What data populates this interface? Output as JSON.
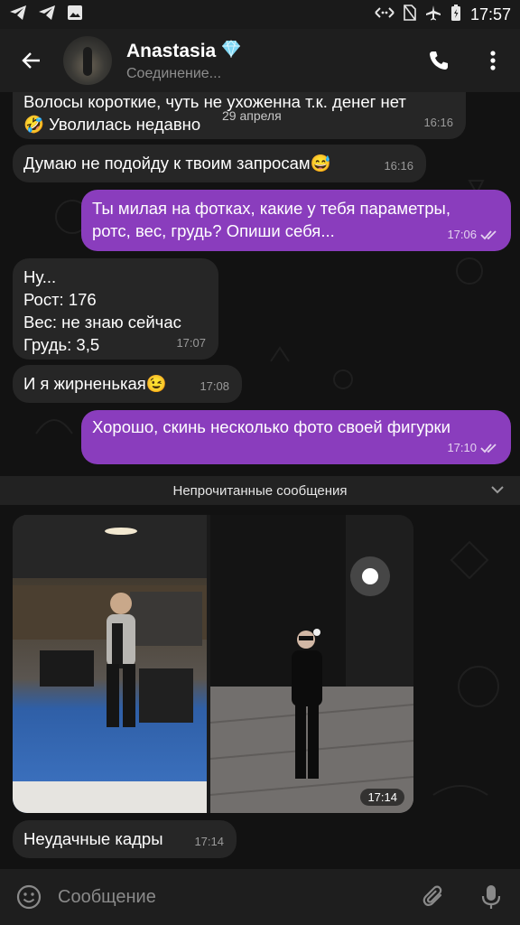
{
  "status_bar": {
    "time": "17:57"
  },
  "header": {
    "name": "Anastasia",
    "status": "Соединение...",
    "verified_icon": "diamond-icon"
  },
  "date_float": "29 апреля",
  "messages": [
    {
      "dir": "in",
      "text_lines": [
        "Волосы короткие, чуть не ухоженна т.к. денег нет",
        "🤣 Уволилась недавно"
      ],
      "time": "16:16"
    },
    {
      "dir": "in",
      "text_lines": [
        "Думаю не подойду к твоим запросам😅"
      ],
      "time": "16:16"
    },
    {
      "dir": "out",
      "text_lines": [
        "Ты милая на фотках, какие у тебя параметры,",
        "ротс, вес, грудь? Опиши себя..."
      ],
      "time": "17:06"
    },
    {
      "dir": "in",
      "text_lines": [
        "Ну...",
        "Рост: 176",
        "Вес: не знаю сейчас",
        "Грудь: 3,5"
      ],
      "time": "17:07"
    },
    {
      "dir": "in",
      "text_lines": [
        "И я жирненькая😉"
      ],
      "time": "17:08"
    },
    {
      "dir": "out",
      "text_lines": [
        "Хорошо, скинь несколько фото своей фигурки"
      ],
      "time": "17:10"
    }
  ],
  "unread_label": "Непрочитанные сообщения",
  "album": {
    "time": "17:14"
  },
  "last_message": {
    "text": "Неудачные кадры",
    "time": "17:14"
  },
  "input": {
    "placeholder": "Сообщение"
  },
  "colors": {
    "accent_out": "#8a3dbd",
    "bubble_in": "#262626",
    "header": "#1e1e1e"
  }
}
